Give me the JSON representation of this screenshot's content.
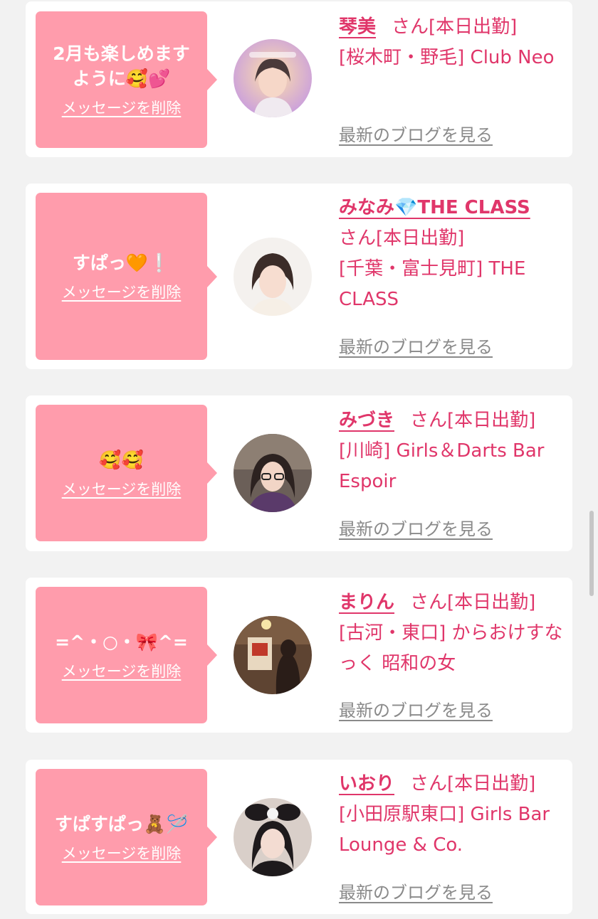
{
  "cards": [
    {
      "message": "2月も楽しめますように🥰💕",
      "delete_label": "メッセージを削除",
      "name": "琴美",
      "suffix": "さん[本日出勤]",
      "shop": "[桜木町・野毛] Club Neo",
      "blog_label": "最新のブログを見る"
    },
    {
      "message": "すぱっ🧡❕",
      "delete_label": "メッセージを削除",
      "name": "みなみ💎THE CLASS",
      "suffix": "さん[本日出勤]",
      "shop": "[千葉・富士見町] THE CLASS",
      "blog_label": "最新のブログを見る"
    },
    {
      "message": "🥰🥰",
      "delete_label": "メッセージを削除",
      "name": "みづき",
      "suffix": "さん[本日出勤]",
      "shop": "[川崎] Girls＆Darts Bar Espoir",
      "blog_label": "最新のブログを見る"
    },
    {
      "message": "=^・○・🎀^=",
      "delete_label": "メッセージを削除",
      "name": "まりん",
      "suffix": "さん[本日出勤]",
      "shop": "[古河・東口] からおけすなっく 昭和の女",
      "blog_label": "最新のブログを見る"
    },
    {
      "message": "すぱすぱっ🧸🪡",
      "delete_label": "メッセージを削除",
      "name": "いおり",
      "suffix": "さん[本日出勤]",
      "shop": "[小田原駅東口] Girls Bar Lounge & Co.",
      "blog_label": "最新のブログを見る"
    }
  ],
  "colors": {
    "bubble": "#ff9cac",
    "accent": "#e0366a",
    "muted_link": "#8a8a8a",
    "background": "#f2f2f2"
  }
}
